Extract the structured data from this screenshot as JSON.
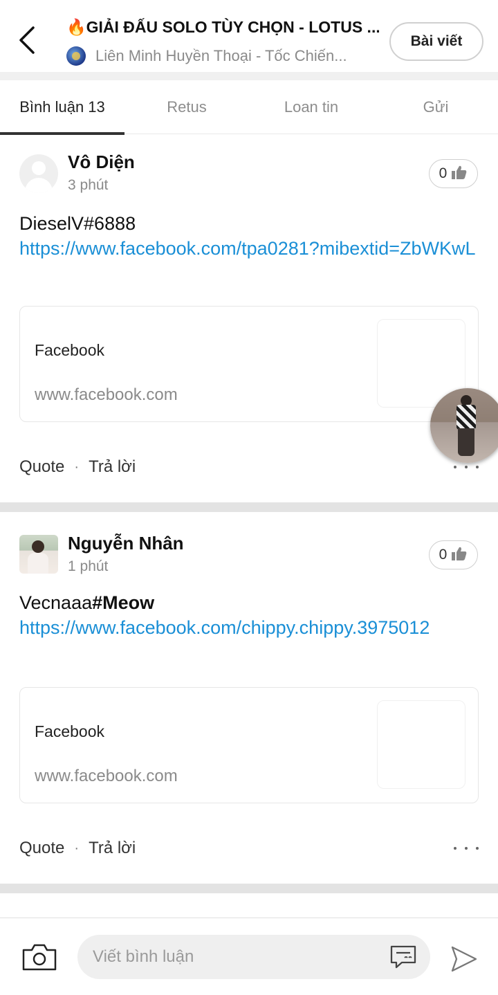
{
  "header": {
    "title": "🔥GIẢI ĐẤU SOLO TÙY CHỌN - LOTUS ...",
    "subtitle": "Liên Minh Huyền Thoại - Tốc Chiến...",
    "post_button": "Bài viết",
    "icons": {
      "back": "back-arrow-icon",
      "community": "community-badge-icon"
    }
  },
  "tabs": [
    {
      "label": "Bình luận 13",
      "active": true
    },
    {
      "label": "Retus",
      "active": false
    },
    {
      "label": "Loan tin",
      "active": false
    },
    {
      "label": "Gửi",
      "active": false
    }
  ],
  "comments": [
    {
      "author": "Vô Diện",
      "time": "3 phút",
      "likes": "0",
      "text_plain": "DieselV#6888",
      "link": "https://www.facebook.com/tpa0281?mibextid=ZbWKwL",
      "card": {
        "title": "Facebook",
        "domain": "www.facebook.com"
      },
      "actions": {
        "quote": "Quote",
        "separator": "·",
        "reply": "Trả lời"
      }
    },
    {
      "author": "Nguyễn Nhân",
      "time": "1 phút",
      "likes": "0",
      "text_plain": "Vecnaaa",
      "text_bold": "#Meow",
      "link": "https://www.facebook.com/chippy.chippy.3975012",
      "card": {
        "title": "Facebook",
        "domain": "www.facebook.com"
      },
      "actions": {
        "quote": "Quote",
        "separator": "·",
        "reply": "Trả lời"
      }
    }
  ],
  "composer": {
    "placeholder": "Viết bình luận",
    "icons": {
      "camera": "camera-icon",
      "emoji": "emoji-comment-icon",
      "send": "send-icon"
    }
  },
  "colors": {
    "link": "#1a8fd6",
    "separator": "#e3e3e3",
    "muted": "#8a8a8a"
  }
}
